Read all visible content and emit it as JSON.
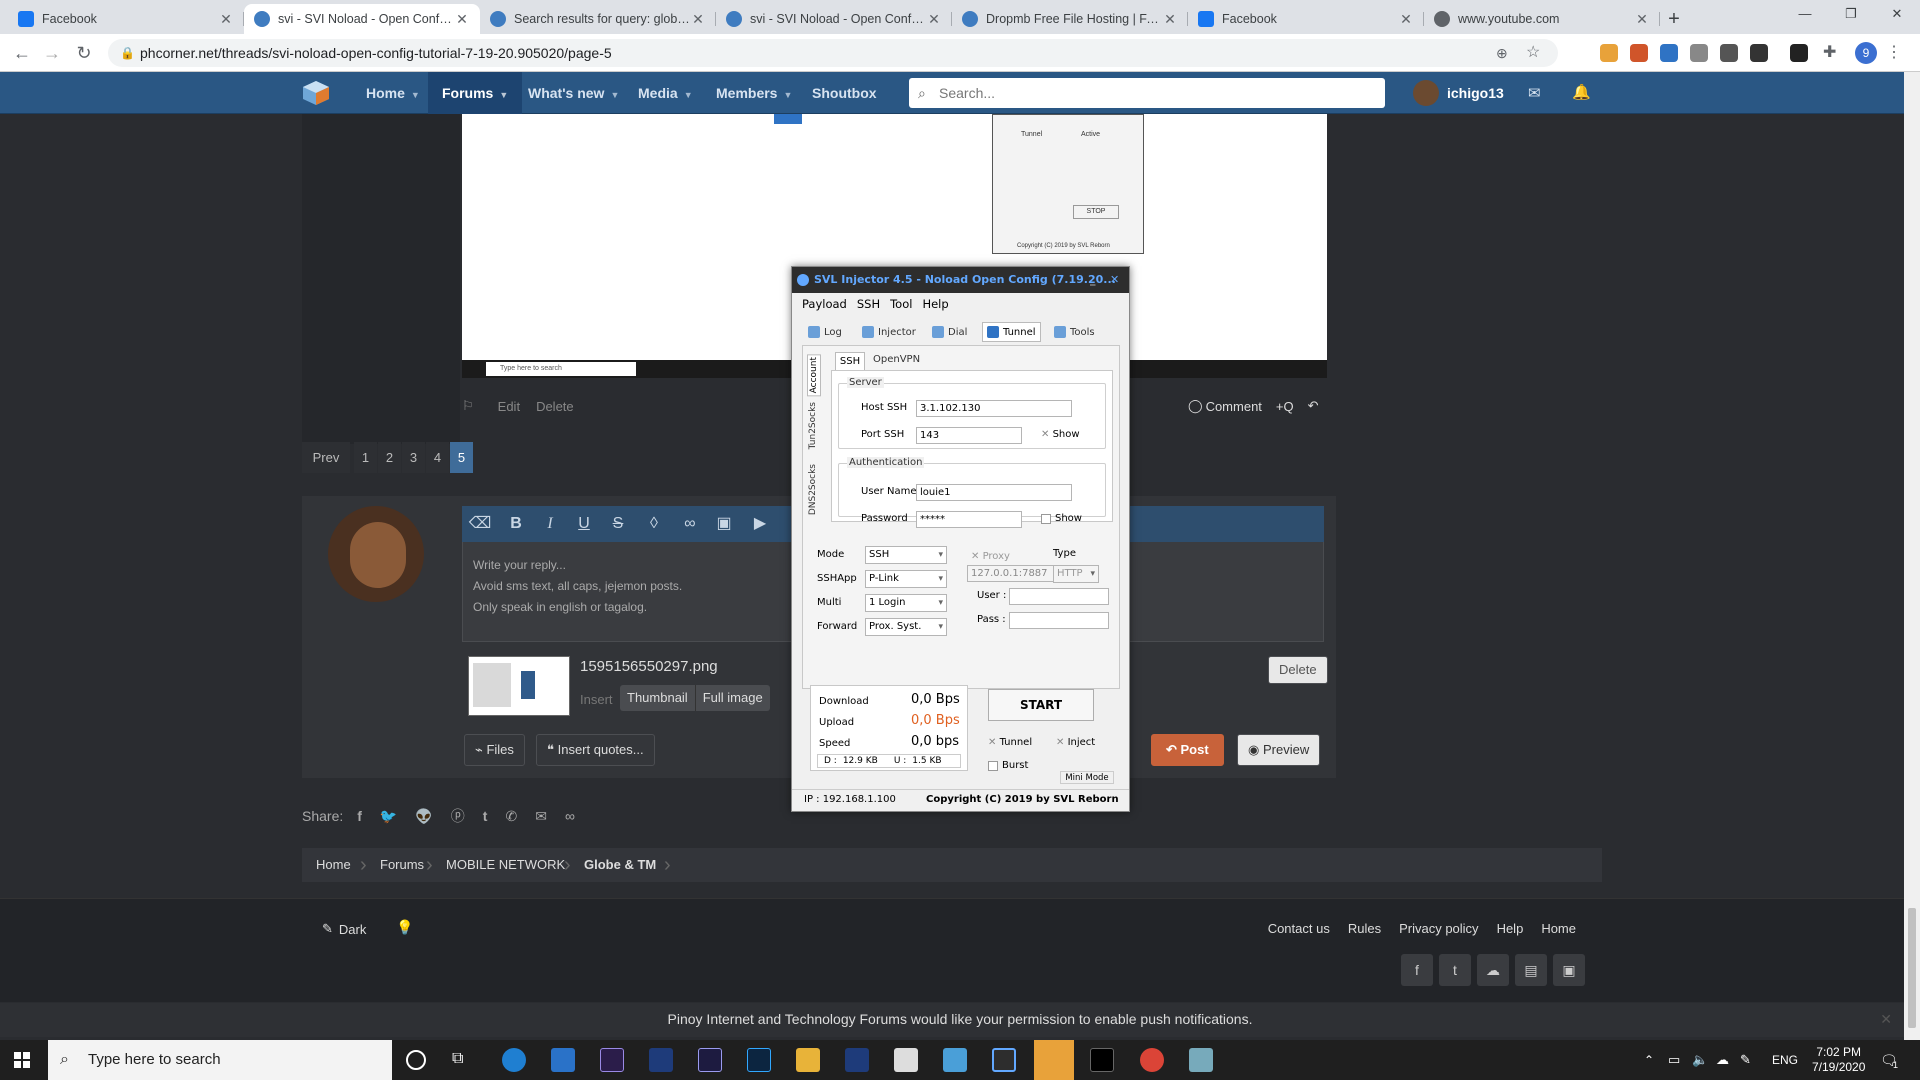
{
  "browser": {
    "tabs": [
      {
        "title": "Facebook",
        "icon": "facebook-icon",
        "active": false
      },
      {
        "title": "svi - SVI Noload - Open Config -",
        "icon": "phcorner-icon",
        "active": true
      },
      {
        "title": "Search results for query: globe S",
        "icon": "phcorner-icon",
        "active": false
      },
      {
        "title": "svi - SVI Noload - Open Config -",
        "icon": "phcorner-icon",
        "active": false
      },
      {
        "title": "Dropmb Free File Hosting | FAST",
        "icon": "phcorner-icon",
        "active": false
      },
      {
        "title": "Facebook",
        "icon": "facebook-icon",
        "active": false
      },
      {
        "title": "www.youtube.com",
        "icon": "globe-icon",
        "active": false
      }
    ],
    "url": "phcorner.net/threads/svi-noload-open-config-tutorial-7-19-20.905020/page-5",
    "profile_initial": "9"
  },
  "site_nav": {
    "items": [
      {
        "label": "Home",
        "caret": true
      },
      {
        "label": "Forums",
        "caret": true,
        "active": true
      },
      {
        "label": "What's new",
        "caret": true
      },
      {
        "label": "Media",
        "caret": true
      },
      {
        "label": "Members",
        "caret": true
      },
      {
        "label": "Shoutbox",
        "caret": false
      }
    ],
    "search_placeholder": "Search...",
    "username": "ichigo13"
  },
  "post_actions": {
    "edit": "Edit",
    "delete": "Delete",
    "comment": "Comment",
    "quote": "+Q"
  },
  "pagination": {
    "prev": "Prev",
    "pages": [
      "1",
      "2",
      "3",
      "4",
      "5"
    ],
    "current": "5"
  },
  "reply": {
    "placeholder_lines": [
      "Write your reply...",
      "Avoid sms text, all caps, jejemon posts.",
      "Only speak in english or tagalog."
    ],
    "attachment": {
      "filename": "1595156550297.png",
      "insert": "Insert",
      "thumbnail": "Thumbnail",
      "full_image": "Full image",
      "delete": "Delete"
    },
    "files": "Files",
    "insert_quotes": "Insert quotes...",
    "post": "Post",
    "preview": "Preview"
  },
  "share": {
    "label": "Share:"
  },
  "breadcrumb": [
    "Home",
    "Forums",
    "MOBILE NETWORK",
    "Globe & TM"
  ],
  "footer": {
    "dark": "Dark",
    "links": [
      "Contact us",
      "Rules",
      "Privacy policy",
      "Help",
      "Home"
    ]
  },
  "push_notice": "Pinoy Internet and Technology Forums would like your permission to enable push notifications.",
  "injector": {
    "title": "SVL Injector 4.5 - Noload Open Config (7.19.20...",
    "menu": [
      "Payload",
      "SSH",
      "Tool",
      "Help"
    ],
    "tabs": [
      "Log",
      "Injector",
      "Dial",
      "Tunnel",
      "Tools"
    ],
    "active_tab": "Tunnel",
    "side_tabs": [
      "Account",
      "Tun2Socks",
      "DNS2Socks"
    ],
    "sub_tabs": [
      "SSH",
      "OpenVPN"
    ],
    "server_group": "Server",
    "host_label": "Host SSH",
    "host_value": "3.1.102.130",
    "port_label": "Port SSH",
    "port_value": "143",
    "show": "Show",
    "auth_group": "Authentication",
    "user_label": "User Name",
    "user_value": "louie1",
    "pass_label": "Password",
    "pass_value": "*****",
    "mode_label": "Mode",
    "mode_value": "SSH",
    "sshapp_label": "SSHApp",
    "sshapp_value": "P-Link",
    "multi_label": "Multi",
    "multi_value": "1 Login",
    "forward_label": "Forward",
    "forward_value": "Prox. Syst.",
    "proxy_label": "Proxy",
    "proxy_value": "127.0.0.1:7887",
    "type_label": "Type",
    "type_value": "HTTP",
    "puser_label": "User :",
    "ppass_label": "Pass :",
    "download_label": "Download",
    "download_value": "0,0 Bps",
    "upload_label": "Upload",
    "upload_value": "0,0 Bps",
    "speed_label": "Speed",
    "speed_value": "0,0 bps",
    "d_label": "D :",
    "d_value": "12.9 KB",
    "u_label": "U :",
    "u_value": "1.5 KB",
    "start": "START",
    "tunnel_chk": "Tunnel",
    "inject_chk": "Inject",
    "burst_chk": "Burst",
    "mini_mode": "Mini Mode",
    "ip": "IP : 192.168.1.100",
    "copyright": "Copyright (C) 2019 by SVL Reborn",
    "accent": "#62a8ff",
    "upload_color": "#e06020"
  },
  "embedded_shot": {
    "tunnel_label": "Tunnel",
    "active_label": "Active",
    "stop": "STOP",
    "search": "Type here to search",
    "copyright": "Copyright (C) 2019 by SVL Reborn"
  },
  "taskbar": {
    "search_placeholder": "Type here to search",
    "lang": "ENG",
    "time": "7:02 PM",
    "date": "7/19/2020",
    "notif_count": "1"
  },
  "colors": {
    "site_nav": "#2a5784",
    "post_button": "#c8623a",
    "page_bg": "#2a2c30"
  }
}
